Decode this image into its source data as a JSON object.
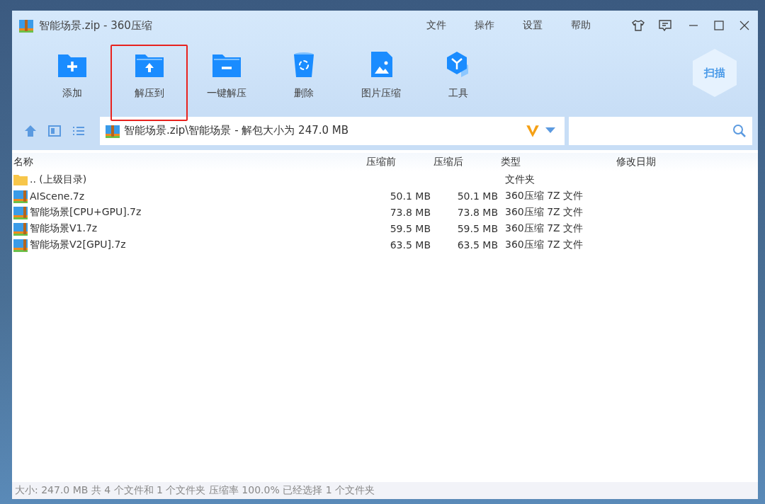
{
  "window": {
    "title": "智能场景.zip - 360压缩"
  },
  "menu": [
    "文件",
    "操作",
    "设置",
    "帮助"
  ],
  "toolbar": [
    {
      "label": "添加",
      "kind": "add",
      "highlighted": false
    },
    {
      "label": "解压到",
      "kind": "extract",
      "highlighted": true
    },
    {
      "label": "一键解压",
      "kind": "oneclick",
      "highlighted": false
    },
    {
      "label": "删除",
      "kind": "delete",
      "highlighted": false
    },
    {
      "label": "图片压缩",
      "kind": "image",
      "highlighted": false
    },
    {
      "label": "工具",
      "kind": "tools",
      "highlighted": false
    }
  ],
  "scan_button": "扫描",
  "address": {
    "path": "智能场景.zip\\智能场景 - 解包大小为 247.0 MB"
  },
  "table": {
    "columns": [
      "名称",
      "压缩前",
      "压缩后",
      "类型",
      "修改日期"
    ],
    "rows": [
      {
        "kind": "folder",
        "name": ".. (上级目录)",
        "before": "",
        "after": "",
        "type": "文件夹"
      },
      {
        "kind": "archive",
        "name": "AIScene.7z",
        "before": "50.1 MB",
        "after": "50.1 MB",
        "type": "360压缩 7Z 文件"
      },
      {
        "kind": "archive",
        "name": "智能场景[CPU+GPU].7z",
        "before": "73.8 MB",
        "after": "73.8 MB",
        "type": "360压缩 7Z 文件"
      },
      {
        "kind": "archive",
        "name": "智能场景V1.7z",
        "before": "59.5 MB",
        "after": "59.5 MB",
        "type": "360压缩 7Z 文件"
      },
      {
        "kind": "archive",
        "name": "智能场景V2[GPU].7z",
        "before": "63.5 MB",
        "after": "63.5 MB",
        "type": "360压缩 7Z 文件"
      }
    ]
  },
  "status_bar": "大小: 247.0 MB 共 4 个文件和 1 个文件夹 压缩率 100.0% 已经选择 1 个文件夹"
}
